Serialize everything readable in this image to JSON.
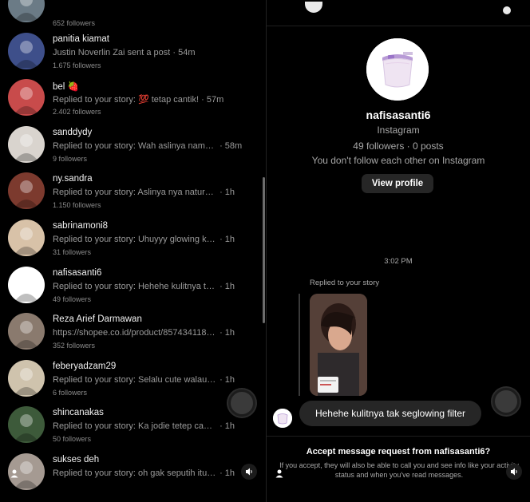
{
  "inbox": [
    {
      "name": "",
      "message": "",
      "time": "",
      "followers": "652 followers",
      "avatar": "avatar-group-icon",
      "avatar_bg": "#6b7b86"
    },
    {
      "name": "panitia kiamat",
      "message": "Justin Noverlin Zai sent a post",
      "time": "· 54m",
      "followers": "1.675 followers",
      "avatar": "avatar-group-icon",
      "avatar_bg": "#3e4f8a"
    },
    {
      "name": "bel 🍓",
      "message": "Replied to your story: 💯 tetap cantik!",
      "time": "· 57m",
      "followers": "2.402 followers",
      "avatar": "avatar-person-icon",
      "avatar_bg": "#c84b4b"
    },
    {
      "name": "sanddydy",
      "message": "Replied to your story: Wah aslinya nama...",
      "time": "· 58m",
      "followers": "9 followers",
      "avatar": "avatar-pattern-icon",
      "avatar_bg": "#d9d4ce"
    },
    {
      "name": "ny.sandra",
      "message": "Replied to your story: Aslinya nya natural t...",
      "time": "· 1h",
      "followers": "1.150 followers",
      "avatar": "avatar-person-icon",
      "avatar_bg": "#7c3a2e"
    },
    {
      "name": "sabrinamoni8",
      "message": "Replied to your story: Uhuyyy glowing kar...",
      "time": "· 1h",
      "followers": "31 followers",
      "avatar": "avatar-person-icon",
      "avatar_bg": "#d8c2a8"
    },
    {
      "name": "nafisasanti6",
      "message": "Replied to your story: Hehehe kulitnya tak...",
      "time": "· 1h",
      "followers": "49 followers",
      "avatar": "avatar-faceshield-icon",
      "avatar_bg": "#ffffff"
    },
    {
      "name": "Reza Arief Darmawan",
      "message": "https://shopee.co.id/product/857434118/2...",
      "time": "· 1h",
      "followers": "352 followers",
      "avatar": "avatar-person-icon",
      "avatar_bg": "#8a7a6e"
    },
    {
      "name": "feberyadzam29",
      "message": "Replied to your story: Selalu cute walau filt...",
      "time": "· 1h",
      "followers": "6 followers",
      "avatar": "avatar-product-icon",
      "avatar_bg": "#cfc3ad"
    },
    {
      "name": "shincanakas",
      "message": "Replied to your story: Ka jodie tetep cantik...",
      "time": "· 1h",
      "followers": "50 followers",
      "avatar": "avatar-plant-icon",
      "avatar_bg": "#3d5a3a"
    },
    {
      "name": "sukses deh",
      "message": "Replied to your story: oh gak seputih itu te...",
      "time": "· 1h",
      "followers": "",
      "avatar": "avatar-person-icon",
      "avatar_bg": "#a59a92"
    }
  ],
  "profile": {
    "username": "nafisasanti6",
    "platform": "Instagram",
    "stats": "49 followers · 0 posts",
    "relation": "You don't follow each other on Instagram",
    "view_profile_label": "View profile"
  },
  "conversation": {
    "timestamp": "3:02 PM",
    "replied_label": "Replied to your story",
    "message": "Hehehe kulitnya tak seglowing filter"
  },
  "request": {
    "title": "Accept message request from nafisasanti6?",
    "body": "If you accept, they will also be able to call you and see info like your activity status and when you've read messages."
  },
  "colors": {
    "background": "#000000",
    "bubble": "#262626",
    "secondary_text": "#a8a8a8",
    "button": "#262626"
  }
}
